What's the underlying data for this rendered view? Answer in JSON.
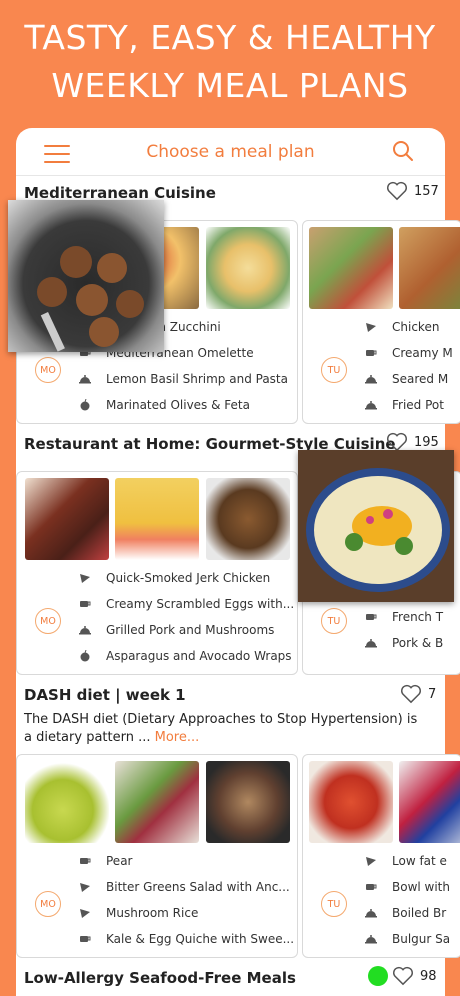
{
  "hero": {
    "line1": "TASTY, EASY & HEALTHY",
    "line2": "WEEKLY MEAL PLANS"
  },
  "nav": {
    "title": "Choose a meal plan"
  },
  "accent": "#f27d3e",
  "background": "#f9874f",
  "sections": [
    {
      "title": "Mediterranean Cuisine",
      "likes": "157",
      "cards": [
        {
          "day": "MO",
          "items": [
            {
              "icon": "pizza-icon",
              "text": "Kofta with Zucchini"
            },
            {
              "icon": "cup-icon",
              "text": "Mediterranean Omelette"
            },
            {
              "icon": "cloche-icon",
              "text": "Lemon Basil Shrimp and Pasta"
            },
            {
              "icon": "apple-icon",
              "text": "Marinated Olives & Feta"
            }
          ]
        },
        {
          "day": "TU",
          "items": [
            {
              "icon": "pizza-icon",
              "text": "Chicken"
            },
            {
              "icon": "cup-icon",
              "text": "Creamy M"
            },
            {
              "icon": "cloche-icon",
              "text": "Seared M"
            },
            {
              "icon": "cloche-icon",
              "text": "Fried Pot"
            }
          ]
        }
      ]
    },
    {
      "title": "Restaurant at Home: Gourmet-Style Cuisine",
      "likes": "195",
      "cards": [
        {
          "day": "MO",
          "items": [
            {
              "icon": "pizza-icon",
              "text": "Quick-Smoked Jerk Chicken"
            },
            {
              "icon": "cup-icon",
              "text": "Creamy Scrambled Eggs with..."
            },
            {
              "icon": "cloche-icon",
              "text": "Grilled Pork and Mushrooms"
            },
            {
              "icon": "apple-icon",
              "text": "Asparagus and Avocado Wraps"
            }
          ]
        },
        {
          "day": "TU",
          "items": [
            {
              "icon": "cup-icon",
              "text": "French T"
            },
            {
              "icon": "cloche-icon",
              "text": "Pork & B"
            }
          ]
        }
      ]
    },
    {
      "title": "DASH diet | week 1",
      "likes": "7",
      "description": "The DASH diet (Dietary Approaches to Stop Hypertension) is a dietary pattern ...",
      "more": "More...",
      "cards": [
        {
          "day": "MO",
          "items": [
            {
              "icon": "cup-icon",
              "text": "Pear"
            },
            {
              "icon": "pizza-icon",
              "text": "Bitter Greens Salad with Anc..."
            },
            {
              "icon": "pizza-icon",
              "text": "Mushroom Rice"
            },
            {
              "icon": "cup-icon",
              "text": "Kale & Egg Quiche with Swee..."
            }
          ]
        },
        {
          "day": "TU",
          "items": [
            {
              "icon": "pizza-icon",
              "text": "Low fat e"
            },
            {
              "icon": "cup-icon",
              "text": "Bowl with"
            },
            {
              "icon": "cloche-icon",
              "text": "Boiled Br"
            },
            {
              "icon": "cloche-icon",
              "text": "Bulgur Sa"
            }
          ]
        }
      ]
    },
    {
      "title": "Low-Allergy Seafood-Free Meals",
      "likes": "98"
    }
  ]
}
